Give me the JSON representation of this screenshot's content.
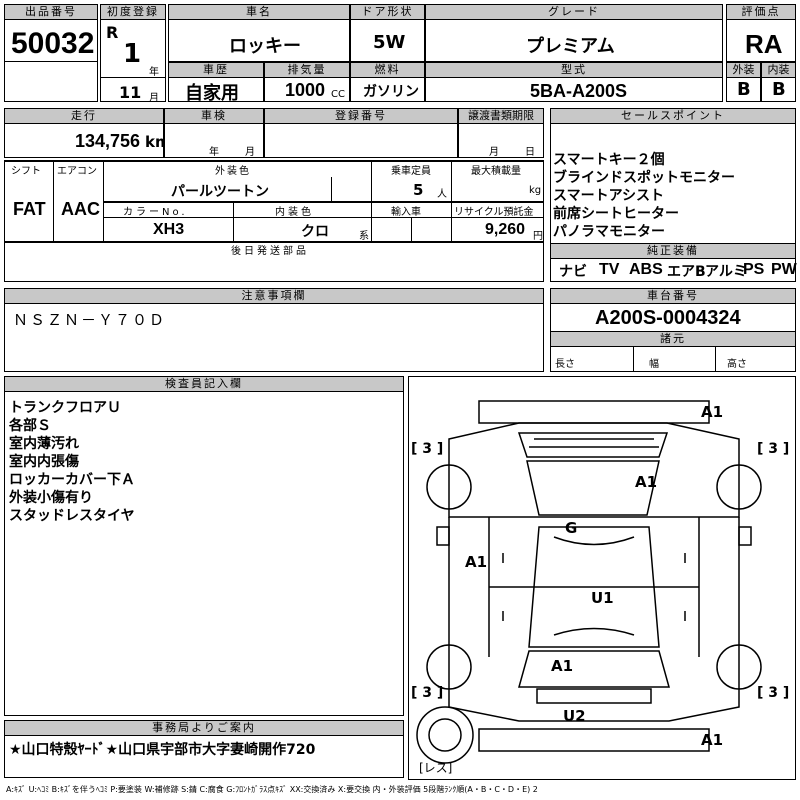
{
  "hdr": {
    "lot_label": "出品番号",
    "first_reg_label": "初度登録",
    "car_name_label": "車名",
    "door_label": "ドア形状",
    "grade_label": "グレード",
    "score_label": "評価点",
    "history_label": "車歴",
    "displacement_label": "排気量",
    "fuel_label": "燃料",
    "model_label": "型式",
    "ext_label": "外装",
    "int_label": "内装"
  },
  "values": {
    "lot_no": "50032",
    "era": "R",
    "year": "1",
    "year_unit": "年",
    "month": "11",
    "month_unit": "月",
    "car_name": "ロッキー",
    "door": "5W",
    "grade": "プレミアム",
    "score": "RA",
    "history": "自家用",
    "displacement": "1000",
    "cc": "CC",
    "fuel": "ガソリン",
    "model": "5BA-A200S",
    "ext_grade": "B",
    "int_grade": "B"
  },
  "row2": {
    "mileage_label": "走行",
    "inspection_label": "車検",
    "plate_label": "登録番号",
    "deadline_label": "譲渡書類期限",
    "sales_label": "セールスポイント",
    "mileage": "134,756",
    "km": "km",
    "nen": "年",
    "tsuki": "月",
    "tsuki2": "月",
    "hi": "日"
  },
  "row3": {
    "shift_label": "シフト",
    "ac_label": "エアコン",
    "color_label": "外装色",
    "capacity_label": "乗車定員",
    "load_label": "最大積載量",
    "shift": "FAT",
    "ac": "AAC",
    "color": "パールツートン",
    "capacity": "5",
    "nin": "人",
    "kg": "kg",
    "color_no_label": "カラーNo.",
    "interior_label": "内装色",
    "import_label": "輸入車",
    "recycle_label": "リサイクル預託金",
    "color_no": "XH3",
    "interior": "クロ",
    "kei": "系",
    "recycle": "9,260",
    "yen": "円",
    "later_parts_label": "後日発送部品"
  },
  "sales_points": [
    "スマートキー２個",
    "ブラインドスポットモニター",
    "スマートアシスト",
    "前席シートヒーター",
    "パノラマモニター"
  ],
  "equipment": {
    "label": "純正装備",
    "items": [
      "ナビ",
      "TV",
      "ABS",
      "エアB",
      "アルミ",
      "PS",
      "PW"
    ]
  },
  "notes": {
    "label": "注意事項欄",
    "text": "ＮＳＺＮ－Ｙ７０Ｄ"
  },
  "chassis": {
    "label": "車台番号",
    "value": "A200S-0004324",
    "dims_label": "諸元",
    "length": "長さ",
    "width": "幅",
    "height": "高さ"
  },
  "inspector": {
    "label": "検査員記入欄",
    "lines": [
      "トランクフロアＵ",
      "各部Ｓ",
      "室内薄汚れ",
      "室内内張傷",
      "ロッカーカバー下Ａ",
      "外装小傷有り",
      "スタッドレスタイヤ"
    ]
  },
  "diagram": {
    "marks": [
      "A1",
      "A1",
      "G",
      "A1",
      "U1",
      "A1",
      "U2",
      "A1"
    ],
    "tires": [
      "[ 3 ]",
      "[ 3 ]",
      "[ 3 ]",
      "[ 3 ]"
    ],
    "spare": "[レス]"
  },
  "office": {
    "label": "事務局よりご案内",
    "text": "★山口特殼ﾔｰﾄﾞ★山口県宇部市大字妻崎開作720"
  },
  "legend": "A:ｷｽﾞ U:ﾍｺﾐ B:ｷｽﾞを伴うﾍｺﾐ P:要塗装 W:補修跡 S:錆 C:腐食 G:ﾌﾛﾝﾄｶﾞﾗｽ点ｷｽﾞ XX:交換済み X:要交換 内・外装評価 5段階ﾗﾝｸ順(A・B・C・D・E) 2"
}
